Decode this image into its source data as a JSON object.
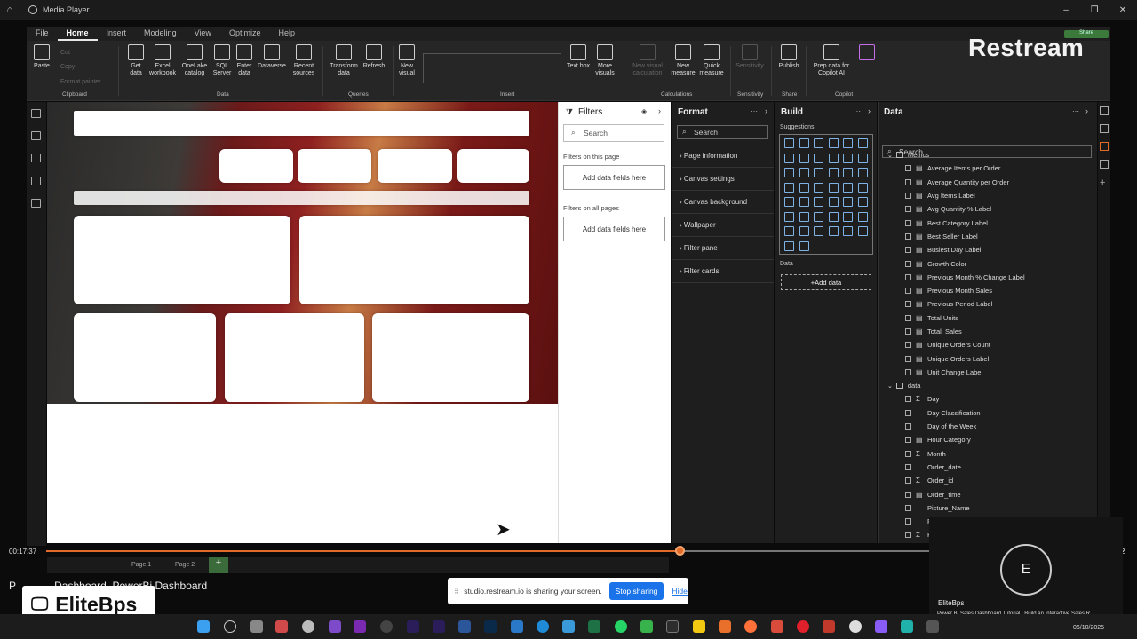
{
  "window": {
    "title": "Media Player"
  },
  "menu": [
    "File",
    "Home",
    "Insert",
    "Modeling",
    "View",
    "Optimize",
    "Help"
  ],
  "ribbon": {
    "clipboard": {
      "paste": "Paste",
      "cut": "Cut",
      "copy": "Copy",
      "format_painter": "Format painter",
      "group": "Clipboard"
    },
    "data": {
      "get_data": "Get data",
      "excel": "Excel workbook",
      "onelake": "OneLake catalog",
      "sql": "SQL Server",
      "enter": "Enter data",
      "dataverse": "Dataverse",
      "recent": "Recent sources",
      "group": "Data"
    },
    "queries": {
      "transform": "Transform data",
      "refresh": "Refresh",
      "group": "Queries"
    },
    "insert": {
      "new_visual": "New visual",
      "text_box": "Text box",
      "more_visuals": "More visuals",
      "group": "Insert"
    },
    "calc": {
      "new_visual_calc": "New visual calculation",
      "new_measure": "New measure",
      "quick_measure": "Quick measure",
      "group": "Calculations"
    },
    "sensitivity": {
      "label": "Sensitivity",
      "group": "Sensitivity"
    },
    "share": {
      "publish": "Publish",
      "group": "Share"
    },
    "copilot": {
      "prep": "Prep data for Copilot AI",
      "copilot": "Copilot",
      "group": "Copilot"
    }
  },
  "overlay": {
    "restream": "Restream",
    "share_btn": "Share"
  },
  "filters": {
    "title": "Filters",
    "search": "Search",
    "this_page": "Filters on this page",
    "all_pages": "Filters on all pages",
    "add_fields": "Add data fields here"
  },
  "format": {
    "title": "Format",
    "search": "Search",
    "sections": [
      "Page information",
      "Canvas settings",
      "Canvas background",
      "Wallpaper",
      "Filter pane",
      "Filter cards"
    ]
  },
  "build": {
    "title": "Build",
    "suggestions": "Suggestions",
    "data_label": "Data",
    "add_data": "+Add data"
  },
  "data_panel": {
    "title": "Data",
    "search": "Search",
    "tables": [
      {
        "name": "Metrics",
        "fields": [
          "Average Items per Order",
          "Average Quantity per Order",
          "Avg Items Label",
          "Avg Quantity % Label",
          "Best Category Label",
          "Best Seller Label",
          "Busiest Day Label",
          "Growth Color",
          "Previous Month % Change Label",
          "Previous Month Sales",
          "Previous Period Label",
          "Total Units",
          "Total_Sales",
          "Unique Orders Count",
          "Unique Orders Label",
          "Unit Change Label"
        ]
      },
      {
        "name": "data",
        "fields": [
          "Day",
          "Day Classification",
          "Day of the Week",
          "Hour Category",
          "Month",
          "Order_date",
          "Order_id",
          "Order_time",
          "Picture_Name",
          "Pi",
          "Pi"
        ],
        "field_icons": [
          "Σ",
          "",
          "",
          "▤",
          "Σ",
          "",
          "Σ",
          "▤",
          "",
          "",
          "Σ"
        ]
      }
    ]
  },
  "pages": {
    "page1": "Page 1",
    "page2": "Page 2"
  },
  "player": {
    "time": "00:17:37",
    "progress": 0.588,
    "right_num": "2"
  },
  "video_title": "P             Dashboard  PowerBi Dashboard",
  "share_bar": {
    "text": "studio.restream.io is sharing your screen.",
    "stop": "Stop sharing",
    "hide": "Hide"
  },
  "brand_logo": "EliteBps",
  "webcam": {
    "initial": "E",
    "name": "EliteBps",
    "caption": "Power BI Sales Dashboard Tutorial | Build an Interactive Sales R..."
  },
  "taskbar": {
    "date": "06/10/2025"
  },
  "colors": {
    "accent": "#e36b2a",
    "stop_button": "#1a73e8"
  }
}
